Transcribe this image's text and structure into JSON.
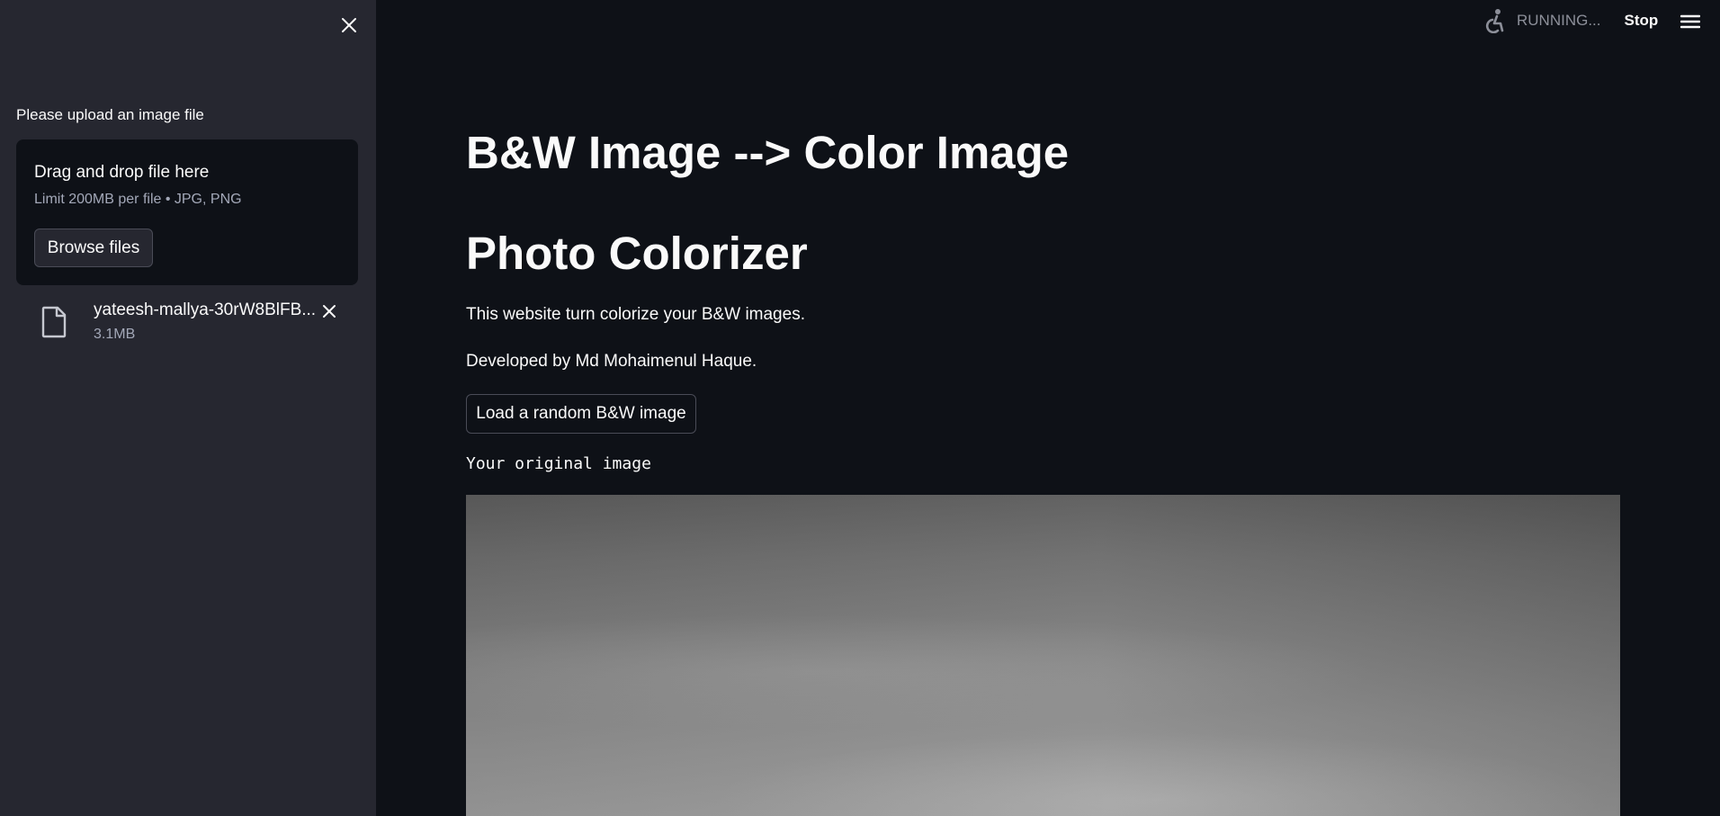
{
  "sidebar": {
    "close_icon": "close-icon",
    "uploader_label": "Please upload an image file",
    "dropzone": {
      "title": "Drag and drop file here",
      "limit": "Limit 200MB per file • JPG, PNG",
      "browse_label": "Browse files"
    },
    "file": {
      "icon": "file-icon",
      "name": "yateesh-mallya-30rW8BlFB...",
      "size": "3.1MB",
      "remove_icon": "close-icon"
    }
  },
  "header": {
    "status_icon": "running-icon",
    "status_text": "RUNNING...",
    "stop_label": "Stop",
    "menu_icon": "hamburger-menu-icon"
  },
  "main": {
    "title": "B&W Image --> Color Image",
    "subtitle": "Photo Colorizer",
    "description": "This website turn colorize your B&W images.",
    "credit": "Developed by Md Mohaimenul Haque.",
    "random_button_label": "Load a random B&W image",
    "image_caption": "Your original image"
  },
  "colors": {
    "background": "#0e1117",
    "sidebar_background": "#262730",
    "text": "#fafafa",
    "muted_text": "#a3a8b8",
    "border": "#4a4c57"
  }
}
